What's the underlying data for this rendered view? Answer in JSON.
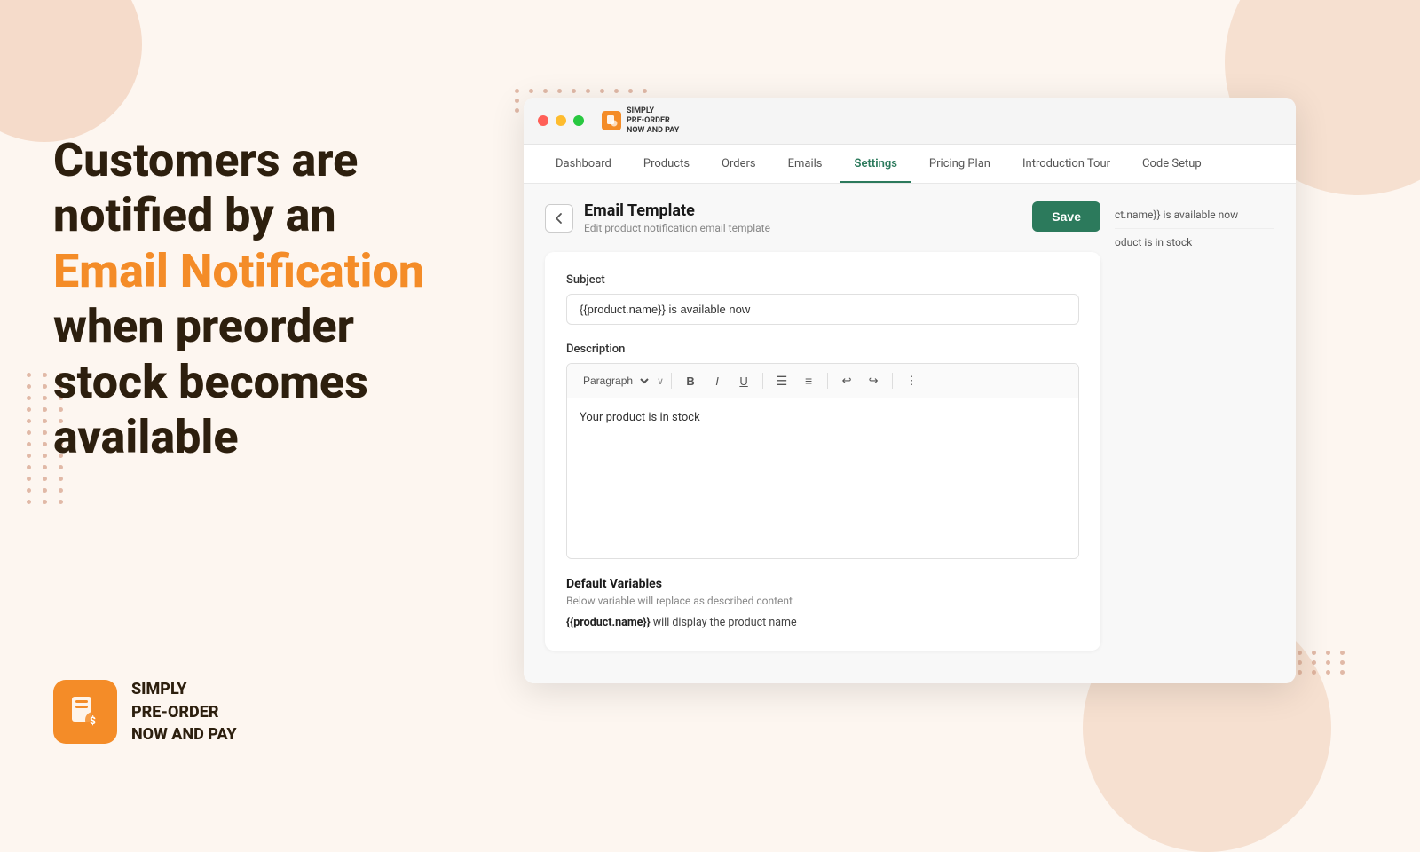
{
  "background": {
    "color": "#fdf6f0"
  },
  "left_panel": {
    "line1": "Customers are",
    "line2": "notified by an",
    "highlight": "Email Notification",
    "line3": "when preorder",
    "line4": "stock becomes",
    "line5": "available"
  },
  "logo": {
    "line1": "SIMPLY",
    "line2": "PRE-ORDER",
    "line3": "NOW AND PAY"
  },
  "nav": {
    "items": [
      {
        "label": "Dashboard",
        "active": false
      },
      {
        "label": "Products",
        "active": false
      },
      {
        "label": "Orders",
        "active": false
      },
      {
        "label": "Emails",
        "active": false
      },
      {
        "label": "Settings",
        "active": true
      },
      {
        "label": "Pricing Plan",
        "active": false
      },
      {
        "label": "Introduction Tour",
        "active": false
      },
      {
        "label": "Code Setup",
        "active": false
      }
    ]
  },
  "page": {
    "title": "Email Template",
    "subtitle": "Edit product notification email template",
    "save_button": "Save"
  },
  "form": {
    "subject_label": "Subject",
    "subject_value": "{{product.name}} is available now",
    "description_label": "Description",
    "editor_content": "Your product is in stock",
    "paragraph_label": "Paragraph"
  },
  "variables": {
    "title": "Default Variables",
    "subtitle": "Below variable will replace as described content",
    "items": [
      {
        "variable": "{{product.name}}",
        "description": " will display the product name"
      }
    ]
  },
  "preview": {
    "items": [
      "ct.name}} is available now",
      "oduct is in stock"
    ]
  },
  "toolbar": {
    "bold": "B",
    "italic": "I",
    "underline": "U",
    "list_unordered": "≡",
    "list_ordered": "≣",
    "undo": "↩",
    "redo": "↪",
    "more": "⋮"
  }
}
